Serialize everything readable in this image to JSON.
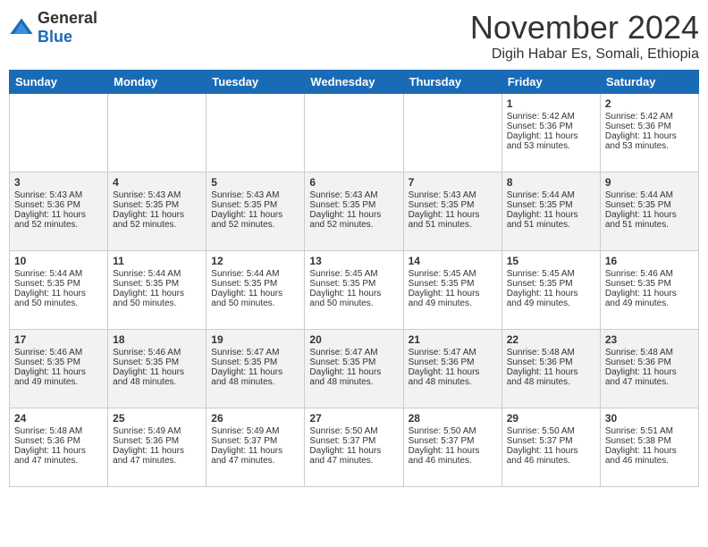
{
  "header": {
    "logo_general": "General",
    "logo_blue": "Blue",
    "month_title": "November 2024",
    "location": "Digih Habar Es, Somali, Ethiopia"
  },
  "days_of_week": [
    "Sunday",
    "Monday",
    "Tuesday",
    "Wednesday",
    "Thursday",
    "Friday",
    "Saturday"
  ],
  "weeks": [
    [
      {
        "day": "",
        "sunrise": "",
        "sunset": "",
        "daylight": ""
      },
      {
        "day": "",
        "sunrise": "",
        "sunset": "",
        "daylight": ""
      },
      {
        "day": "",
        "sunrise": "",
        "sunset": "",
        "daylight": ""
      },
      {
        "day": "",
        "sunrise": "",
        "sunset": "",
        "daylight": ""
      },
      {
        "day": "",
        "sunrise": "",
        "sunset": "",
        "daylight": ""
      },
      {
        "day": "1",
        "sunrise": "Sunrise: 5:42 AM",
        "sunset": "Sunset: 5:36 PM",
        "daylight": "Daylight: 11 hours and 53 minutes."
      },
      {
        "day": "2",
        "sunrise": "Sunrise: 5:42 AM",
        "sunset": "Sunset: 5:36 PM",
        "daylight": "Daylight: 11 hours and 53 minutes."
      }
    ],
    [
      {
        "day": "3",
        "sunrise": "Sunrise: 5:43 AM",
        "sunset": "Sunset: 5:36 PM",
        "daylight": "Daylight: 11 hours and 52 minutes."
      },
      {
        "day": "4",
        "sunrise": "Sunrise: 5:43 AM",
        "sunset": "Sunset: 5:35 PM",
        "daylight": "Daylight: 11 hours and 52 minutes."
      },
      {
        "day": "5",
        "sunrise": "Sunrise: 5:43 AM",
        "sunset": "Sunset: 5:35 PM",
        "daylight": "Daylight: 11 hours and 52 minutes."
      },
      {
        "day": "6",
        "sunrise": "Sunrise: 5:43 AM",
        "sunset": "Sunset: 5:35 PM",
        "daylight": "Daylight: 11 hours and 52 minutes."
      },
      {
        "day": "7",
        "sunrise": "Sunrise: 5:43 AM",
        "sunset": "Sunset: 5:35 PM",
        "daylight": "Daylight: 11 hours and 51 minutes."
      },
      {
        "day": "8",
        "sunrise": "Sunrise: 5:44 AM",
        "sunset": "Sunset: 5:35 PM",
        "daylight": "Daylight: 11 hours and 51 minutes."
      },
      {
        "day": "9",
        "sunrise": "Sunrise: 5:44 AM",
        "sunset": "Sunset: 5:35 PM",
        "daylight": "Daylight: 11 hours and 51 minutes."
      }
    ],
    [
      {
        "day": "10",
        "sunrise": "Sunrise: 5:44 AM",
        "sunset": "Sunset: 5:35 PM",
        "daylight": "Daylight: 11 hours and 50 minutes."
      },
      {
        "day": "11",
        "sunrise": "Sunrise: 5:44 AM",
        "sunset": "Sunset: 5:35 PM",
        "daylight": "Daylight: 11 hours and 50 minutes."
      },
      {
        "day": "12",
        "sunrise": "Sunrise: 5:44 AM",
        "sunset": "Sunset: 5:35 PM",
        "daylight": "Daylight: 11 hours and 50 minutes."
      },
      {
        "day": "13",
        "sunrise": "Sunrise: 5:45 AM",
        "sunset": "Sunset: 5:35 PM",
        "daylight": "Daylight: 11 hours and 50 minutes."
      },
      {
        "day": "14",
        "sunrise": "Sunrise: 5:45 AM",
        "sunset": "Sunset: 5:35 PM",
        "daylight": "Daylight: 11 hours and 49 minutes."
      },
      {
        "day": "15",
        "sunrise": "Sunrise: 5:45 AM",
        "sunset": "Sunset: 5:35 PM",
        "daylight": "Daylight: 11 hours and 49 minutes."
      },
      {
        "day": "16",
        "sunrise": "Sunrise: 5:46 AM",
        "sunset": "Sunset: 5:35 PM",
        "daylight": "Daylight: 11 hours and 49 minutes."
      }
    ],
    [
      {
        "day": "17",
        "sunrise": "Sunrise: 5:46 AM",
        "sunset": "Sunset: 5:35 PM",
        "daylight": "Daylight: 11 hours and 49 minutes."
      },
      {
        "day": "18",
        "sunrise": "Sunrise: 5:46 AM",
        "sunset": "Sunset: 5:35 PM",
        "daylight": "Daylight: 11 hours and 48 minutes."
      },
      {
        "day": "19",
        "sunrise": "Sunrise: 5:47 AM",
        "sunset": "Sunset: 5:35 PM",
        "daylight": "Daylight: 11 hours and 48 minutes."
      },
      {
        "day": "20",
        "sunrise": "Sunrise: 5:47 AM",
        "sunset": "Sunset: 5:35 PM",
        "daylight": "Daylight: 11 hours and 48 minutes."
      },
      {
        "day": "21",
        "sunrise": "Sunrise: 5:47 AM",
        "sunset": "Sunset: 5:36 PM",
        "daylight": "Daylight: 11 hours and 48 minutes."
      },
      {
        "day": "22",
        "sunrise": "Sunrise: 5:48 AM",
        "sunset": "Sunset: 5:36 PM",
        "daylight": "Daylight: 11 hours and 48 minutes."
      },
      {
        "day": "23",
        "sunrise": "Sunrise: 5:48 AM",
        "sunset": "Sunset: 5:36 PM",
        "daylight": "Daylight: 11 hours and 47 minutes."
      }
    ],
    [
      {
        "day": "24",
        "sunrise": "Sunrise: 5:48 AM",
        "sunset": "Sunset: 5:36 PM",
        "daylight": "Daylight: 11 hours and 47 minutes."
      },
      {
        "day": "25",
        "sunrise": "Sunrise: 5:49 AM",
        "sunset": "Sunset: 5:36 PM",
        "daylight": "Daylight: 11 hours and 47 minutes."
      },
      {
        "day": "26",
        "sunrise": "Sunrise: 5:49 AM",
        "sunset": "Sunset: 5:37 PM",
        "daylight": "Daylight: 11 hours and 47 minutes."
      },
      {
        "day": "27",
        "sunrise": "Sunrise: 5:50 AM",
        "sunset": "Sunset: 5:37 PM",
        "daylight": "Daylight: 11 hours and 47 minutes."
      },
      {
        "day": "28",
        "sunrise": "Sunrise: 5:50 AM",
        "sunset": "Sunset: 5:37 PM",
        "daylight": "Daylight: 11 hours and 46 minutes."
      },
      {
        "day": "29",
        "sunrise": "Sunrise: 5:50 AM",
        "sunset": "Sunset: 5:37 PM",
        "daylight": "Daylight: 11 hours and 46 minutes."
      },
      {
        "day": "30",
        "sunrise": "Sunrise: 5:51 AM",
        "sunset": "Sunset: 5:38 PM",
        "daylight": "Daylight: 11 hours and 46 minutes."
      }
    ]
  ]
}
